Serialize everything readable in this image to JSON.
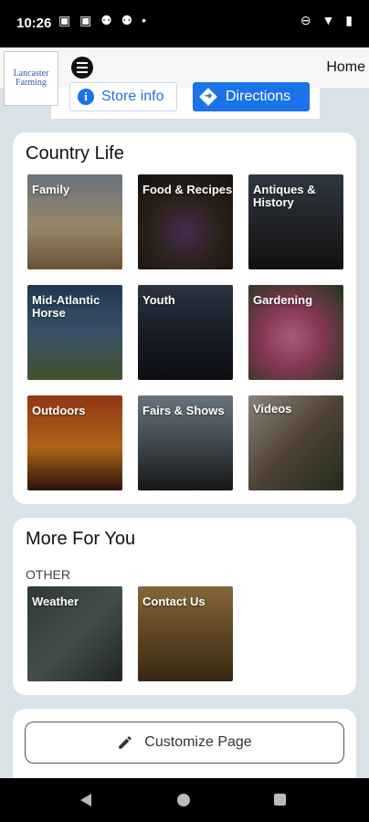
{
  "status_bar": {
    "time": "10:26",
    "left_icons": "▣ ▣ ⚉ ⚉ •",
    "right_icons": "⊖ ▼ ▮"
  },
  "app_bar": {
    "logo_text": "Lancaster Farming",
    "home_label": "Home"
  },
  "store_strip": {
    "store_info_label": "Store info",
    "directions_label": "Directions"
  },
  "country_life": {
    "title": "Country Life",
    "tiles": [
      {
        "label": "Family"
      },
      {
        "label": "Food & Recipes"
      },
      {
        "label": "Antiques & History"
      },
      {
        "label": "Mid-Atlantic Horse"
      },
      {
        "label": "Youth"
      },
      {
        "label": "Gardening"
      },
      {
        "label": "Outdoors"
      },
      {
        "label": "Fairs & Shows"
      },
      {
        "label": "Videos"
      }
    ]
  },
  "more_for_you": {
    "title": "More For You",
    "section_label": "OTHER",
    "tiles": [
      {
        "label": "Weather"
      },
      {
        "label": "Contact Us"
      }
    ]
  },
  "customize": {
    "label": "Customize Page"
  }
}
